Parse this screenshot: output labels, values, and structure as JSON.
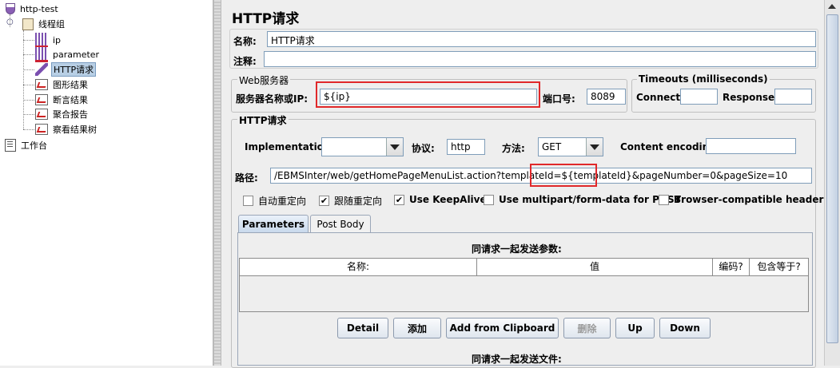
{
  "tree": {
    "root": "http-test",
    "thread_group": "线程组",
    "children": [
      "ip",
      "parameter",
      "HTTP请求",
      "图形结果",
      "断言结果",
      "聚合报告",
      "察看结果树"
    ],
    "workbench": "工作台"
  },
  "panel": {
    "title": "HTTP请求",
    "name_label": "名称:",
    "name_value": "HTTP请求",
    "comment_label": "注释:",
    "comment_value": ""
  },
  "web_server": {
    "legend": "Web服务器",
    "server_label": "服务器名称或IP:",
    "server_value": "${ip}",
    "port_label": "端口号:",
    "port_value": "8089"
  },
  "timeouts": {
    "legend": "Timeouts (milliseconds)",
    "connect_label": "Connect:",
    "connect_value": "",
    "response_label": "Response:",
    "response_value": ""
  },
  "http_request": {
    "legend": "HTTP请求",
    "impl_label": "Implementation:",
    "impl_value": "",
    "protocol_label": "协议:",
    "protocol_value": "http",
    "method_label": "方法:",
    "method_value": "GET",
    "encoding_label": "Content encoding:",
    "encoding_value": "",
    "path_label": "路径:",
    "path_value": "/EBMSInter/web/getHomePageMenuList.action?templateId=${templateId}&pageNumber=0&pageSize=10"
  },
  "options": [
    {
      "label": "自动重定向",
      "checked": false
    },
    {
      "label": "跟随重定向",
      "checked": true
    },
    {
      "label": "Use KeepAlive",
      "checked": true
    },
    {
      "label": "Use multipart/form-data for POST",
      "checked": false
    },
    {
      "label": "Browser-compatible headers",
      "checked": false
    }
  ],
  "tabs": [
    "Parameters",
    "Post Body"
  ],
  "params": {
    "caption": "同请求一起发送参数:",
    "columns": [
      "名称:",
      "值",
      "编码?",
      "包含等于?"
    ]
  },
  "buttons": [
    "Detail",
    "添加",
    "Add from Clipboard",
    "删除",
    "Up",
    "Down"
  ],
  "files_caption": "同请求一起发送文件:"
}
